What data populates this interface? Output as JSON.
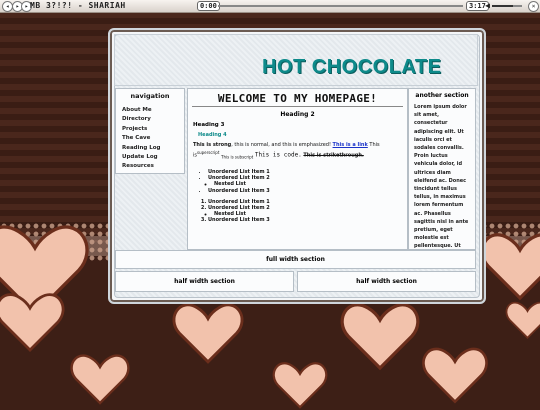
{
  "player": {
    "track_title": "MB 3?!?! - SHARIAH",
    "time_elapsed": "0:00",
    "time_total": "3:17",
    "progress": 0.0
  },
  "site": {
    "title": "HOT CHOCOLATE"
  },
  "nav": {
    "title": "navigation",
    "items": [
      "About Me",
      "Directory",
      "Projects",
      "The Cave",
      "Reading Log",
      "Update Log",
      "Resources"
    ]
  },
  "main": {
    "welcome": "WELCOME TO MY HOMEPAGE!",
    "heading2": "Heading 2",
    "heading3": "Heading 3",
    "heading4": "Heading 4",
    "strong": "This is strong",
    "normal": ", this is normal, and this is emphasized!",
    "link": "This is a link",
    "superscript_pre": "This is",
    "superscript": "superscript",
    "subscript": "This is subscript",
    "code": "This is code.",
    "strike": "This is strikethrough.",
    "ul": [
      "Unordered List Item 1",
      "Unordered List Item 2",
      "Unordered List Item 3"
    ],
    "nested_ul": "Nested List",
    "ol": [
      "Unordered List Item 1",
      "Unordered List Item 2",
      "Unordered List Item 3"
    ],
    "nested_ol": "Nested List"
  },
  "aside": {
    "title": "another section",
    "text": "Lorem ipsum dolor sit amet, consectetur adipiscing elit. Ut iaculis orci et sodales convallis. Proin luctus vehicula dolor, id ultrices diam eleifend ac. Donec tincidunt tellus tellus, in maximus lorem fermentum ac. Phasellus sagittis nisl in ante pretium, eget molestie est pellentesque. Ut tincidunt ultricies porta."
  },
  "sections": {
    "full": "full width section",
    "half_left": "half width section",
    "half_right": "half width section"
  },
  "colors": {
    "accent": "#0d8a8a",
    "background": "#3d1f16",
    "heart": "#f2c2ac"
  }
}
